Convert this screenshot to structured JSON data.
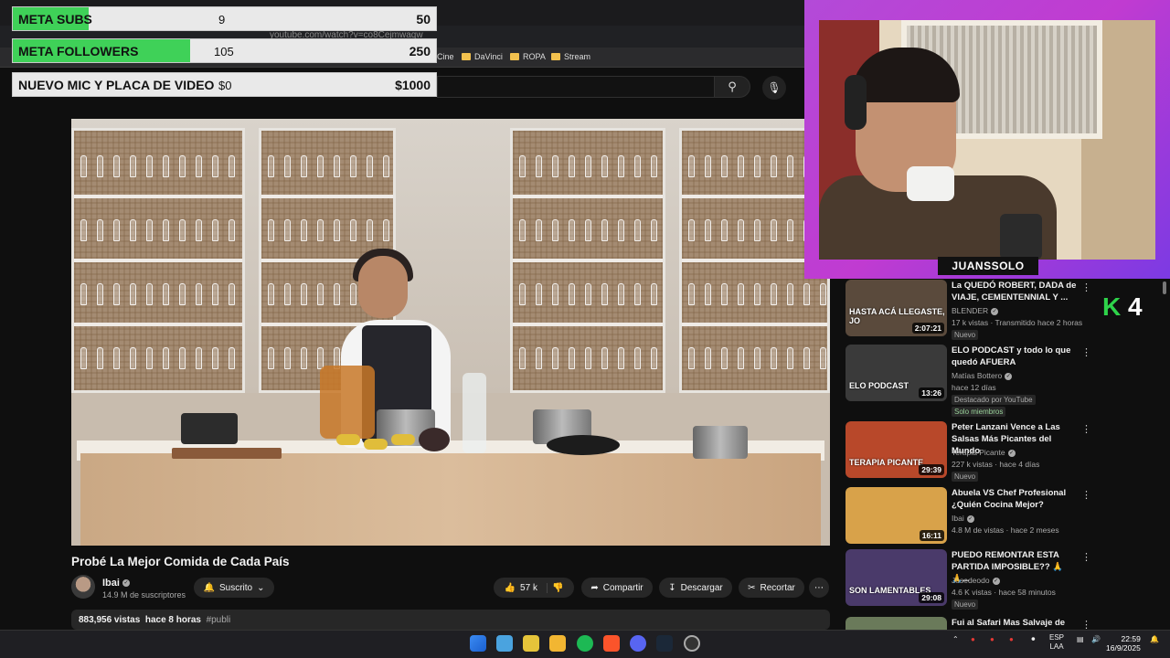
{
  "browser": {
    "address": "youtube.com/watch?v=co8Cejmwaqw",
    "bookmarks": [
      "Cine",
      "DaVinci",
      "ROPA",
      "Stream"
    ]
  },
  "goals": [
    {
      "label": "META SUBS",
      "current": "9",
      "max": "50",
      "progress": 0.18
    },
    {
      "label": "META FOLLOWERS",
      "current": "105",
      "max": "250",
      "progress": 0.42
    },
    {
      "label": "NUEVO MIC Y PLACA DE VIDEO",
      "current": "$0",
      "max": "$1000",
      "progress": 0
    }
  ],
  "video": {
    "title": "Probé La Mejor Comida de Cada País",
    "channel": "Ibai",
    "subscribers": "14.9 M de suscriptores",
    "subscribed_label": "Suscrito",
    "likes": "57 k",
    "share_label": "Compartir",
    "download_label": "Descargar",
    "clip_label": "Recortar",
    "views": "883,956 vistas",
    "time_ago": "hace 8 horas",
    "hashtag": "#publi"
  },
  "webcam": {
    "streamer_name": "JUANSSOLO"
  },
  "logo": {
    "k": "K",
    "num": "4"
  },
  "recommendations": [
    {
      "title": "La QUEDÓ ROBERT, DADA de VIAJE, CEMENTENNIAL Y ...",
      "channel": "BLENDER",
      "meta": "17 k vistas · Transmitido hace 2 horas",
      "badge": "Nuevo",
      "duration": "2:07:21",
      "thumb_text": "HASTA ACÁ LLEGASTE, JO",
      "thumb_color": "#5a4a3c"
    },
    {
      "title": "ELO PODCAST y todo lo que quedó AFUERA",
      "channel": "Matías Bottero",
      "meta": "hace 12 días",
      "badge": "Destacado por YouTube",
      "badge2": "Solo miembros",
      "duration": "13:26",
      "thumb_text": "ELO PODCAST",
      "thumb_color": "#3a3a3a"
    },
    {
      "title": "Peter Lanzani Vence a Las Salsas Más Picantes del Mundo",
      "channel": "Terapia Picante",
      "meta": "227 k vistas · hace 4 días",
      "badge": "Nuevo",
      "duration": "29:39",
      "thumb_text": "TERAPIA PICANTE",
      "thumb_color": "#b8482a"
    },
    {
      "title": "Abuela VS Chef Profesional ¿Quién Cocina Mejor?",
      "channel": "Ibai",
      "meta": "4.8 M de vistas · hace 2 meses",
      "badge": "",
      "duration": "16:11",
      "thumb_text": "",
      "thumb_color": "#d8a24a"
    },
    {
      "title": "PUEDO REMONTAR ESTA PARTIDA IMPOSIBLE?? 🙏🙏...",
      "channel": "Josedeodo",
      "meta": "4.6 K vistas · hace 58 minutos",
      "badge": "Nuevo",
      "duration": "29:08",
      "thumb_text": "SON LAMENTABLES",
      "thumb_color": "#4a3a6a"
    },
    {
      "title": "Fui al Safari Mas Salvaje de",
      "channel": "",
      "meta": "",
      "badge": "",
      "duration": "",
      "thumb_text": "",
      "thumb_color": "#6a7a5a"
    }
  ],
  "taskbar": {
    "lang1": "ESP",
    "lang2": "LAA",
    "time": "22:59",
    "date": "16/9/2025"
  }
}
